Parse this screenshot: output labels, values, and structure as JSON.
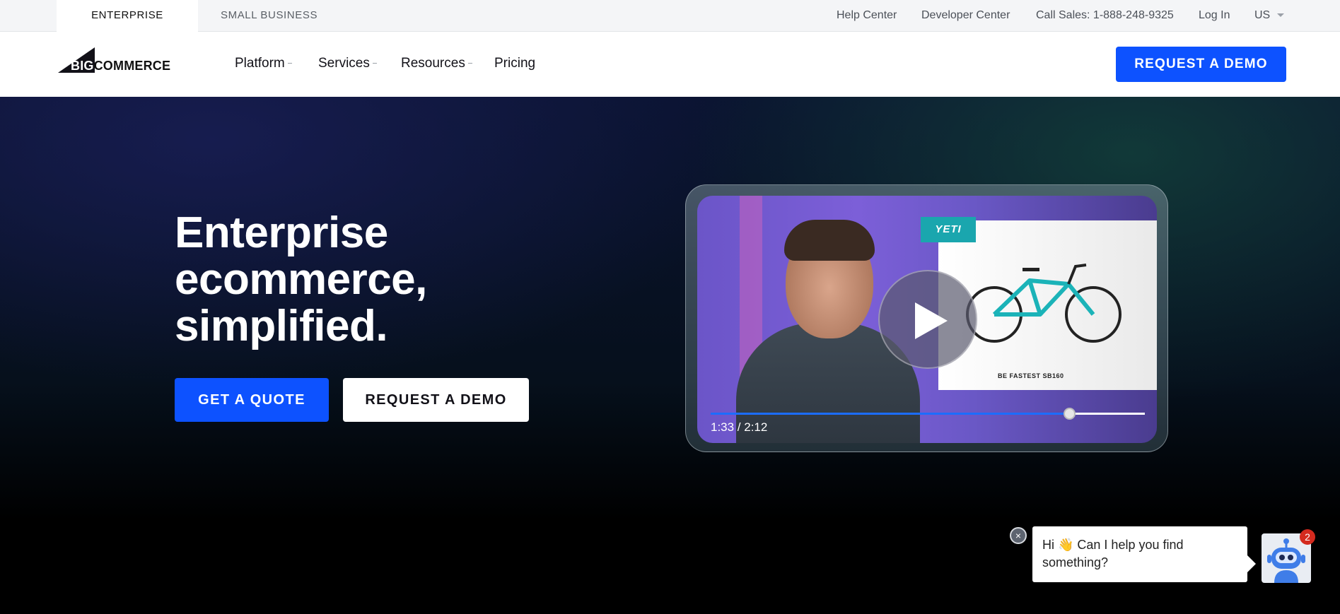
{
  "utility_bar": {
    "tab_enterprise": "ENTERPRISE",
    "tab_small_business": "SMALL BUSINESS",
    "help_center": "Help Center",
    "developer_center": "Developer Center",
    "call_sales": "Call Sales: 1-888-248-9325",
    "log_in": "Log In",
    "locale": "US"
  },
  "nav": {
    "logo_big": "BIG",
    "logo_commerce": "COMMERCE",
    "platform": "Platform",
    "services": "Services",
    "resources": "Resources",
    "pricing": "Pricing",
    "request_demo": "REQUEST A DEMO"
  },
  "hero": {
    "title_line1": "Enterprise",
    "title_line2": "ecommerce,",
    "title_line3": "simplified.",
    "get_quote": "GET A QUOTE",
    "request_demo": "REQUEST A DEMO"
  },
  "video": {
    "brand_tag": "YETI",
    "tagline": "BE FASTEST SB160",
    "time": "1:33 / 2:12",
    "progress": 0.825
  },
  "chat": {
    "close_symbol": "×",
    "message": "Hi 👋 Can I help you find something?",
    "badge_count": "2"
  },
  "colors": {
    "accent": "#0d52ff",
    "dark": "#121118",
    "badge": "#d42a1e"
  }
}
